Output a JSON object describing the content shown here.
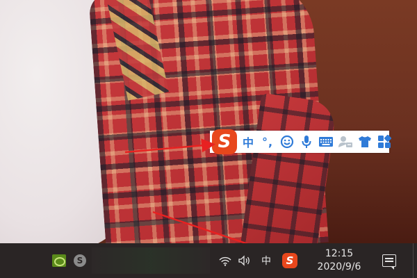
{
  "ime_toolbar": {
    "logo_letter": "S",
    "items": [
      {
        "label": "中",
        "icon": "chinese-mode"
      },
      {
        "label": "°,",
        "icon": "punctuation"
      },
      {
        "label": "",
        "icon": "emoji-smiley-icon"
      },
      {
        "label": "",
        "icon": "microphone-icon"
      },
      {
        "label": "",
        "icon": "keyboard-icon"
      },
      {
        "label": "",
        "icon": "user-card-icon"
      },
      {
        "label": "",
        "icon": "tshirt-skin-icon"
      },
      {
        "label": "",
        "icon": "grid-toolbox-icon"
      }
    ],
    "accent_color": "#2f7bd8",
    "logo_color": "#e8471c"
  },
  "taskbar": {
    "tray_icons": [
      "nvidia-icon",
      "skype-icon",
      "wifi-icon",
      "volume-icon"
    ],
    "ime_mode": "中",
    "sogou_letter": "S",
    "clock": {
      "time": "12:15",
      "date": "2020/9/6"
    },
    "notification_icon": "action-center-icon"
  },
  "annotation": {
    "arrow_color": "#e82121"
  }
}
